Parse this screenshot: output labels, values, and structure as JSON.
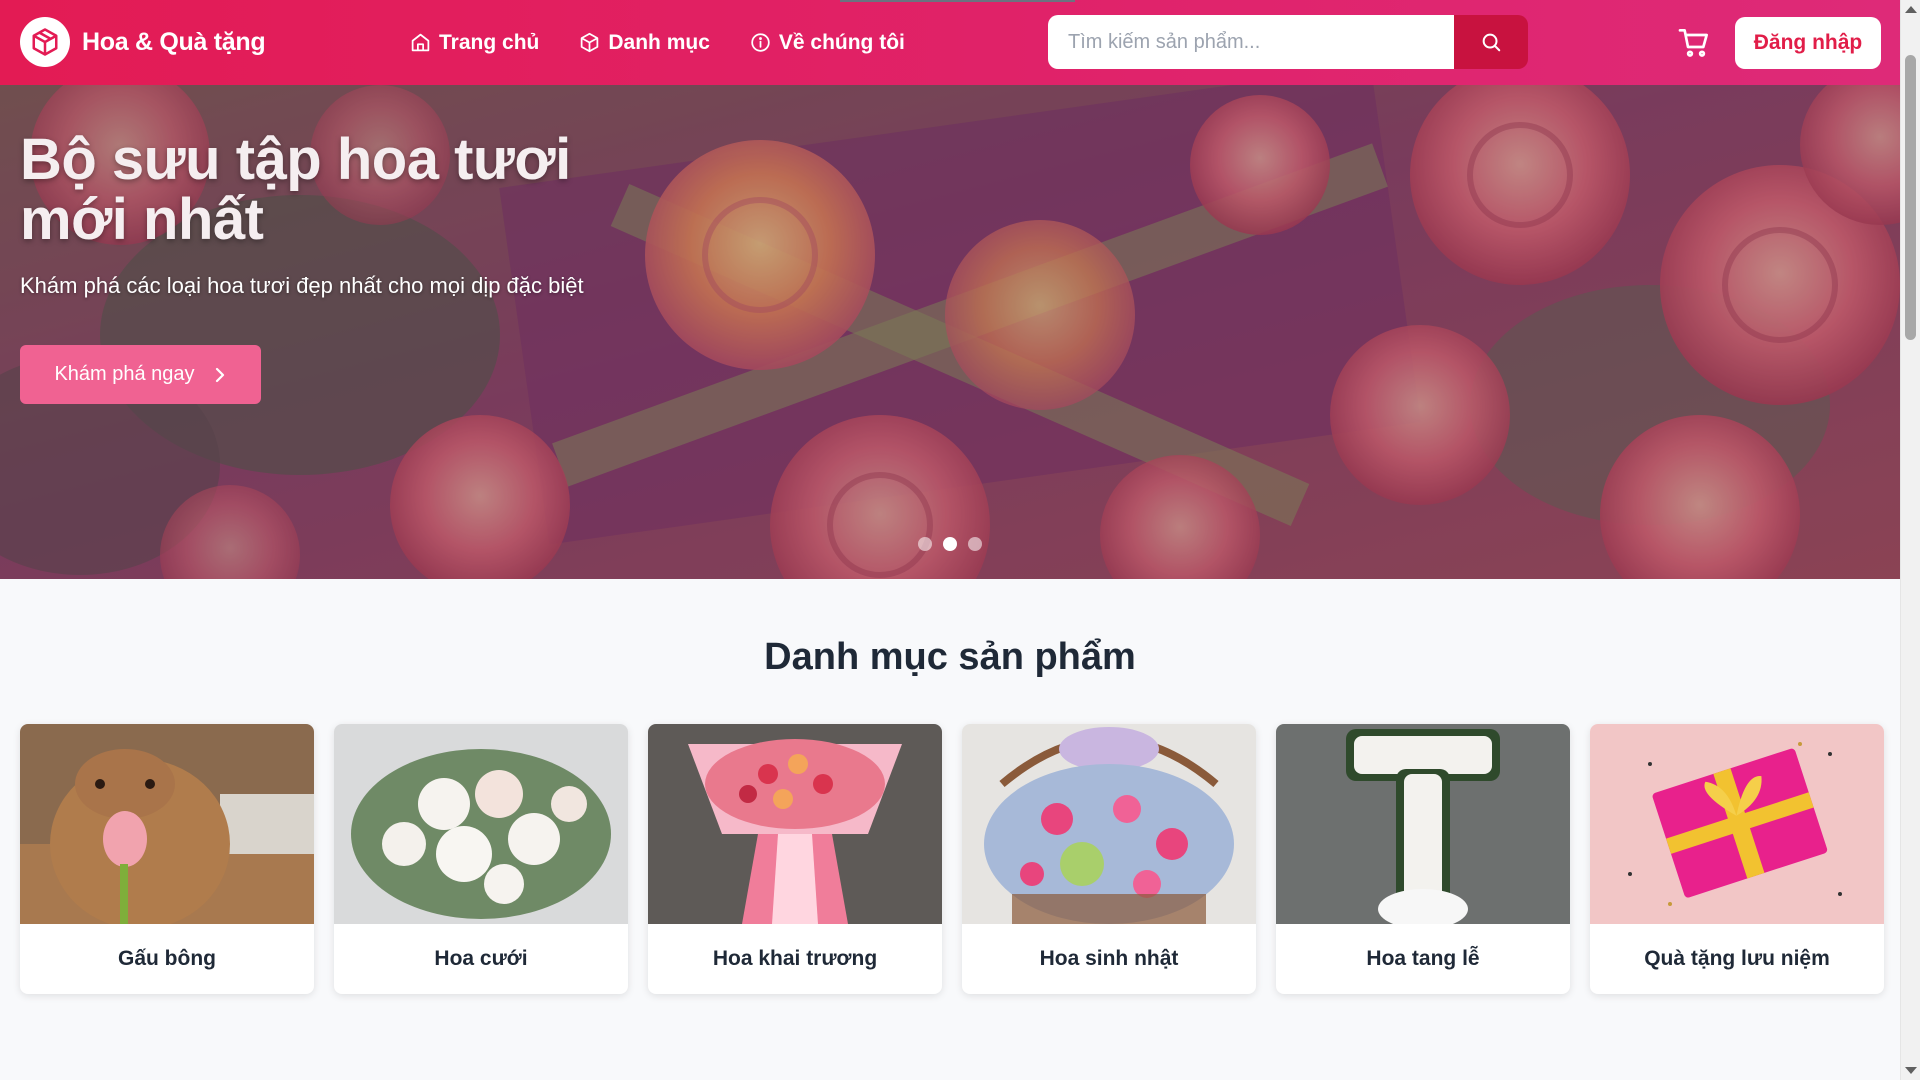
{
  "header": {
    "logo_text": "Hoa & Quà tặng",
    "nav": [
      {
        "label": "Trang chủ",
        "icon": "home-icon"
      },
      {
        "label": "Danh mục",
        "icon": "box-icon"
      },
      {
        "label": "Về chúng tôi",
        "icon": "info-icon"
      }
    ],
    "search_placeholder": "Tìm kiếm sản phẩm...",
    "login_label": "Đăng nhập",
    "colors": {
      "primary": "#e31b54",
      "accent": "#de2a78",
      "search_button": "#c8123f"
    }
  },
  "hero": {
    "title": "Bộ sưu tập hoa tươi mới nhất",
    "subtitle": "Khám phá các loại hoa tươi đẹp nhất cho mọi dịp đặc biệt",
    "cta_label": "Khám phá ngay",
    "slides_total": 3,
    "active_slide": 2,
    "cta_color": "#f06292"
  },
  "categories": {
    "title": "Danh mục sản phẩm",
    "items": [
      {
        "label": "Gấu bông"
      },
      {
        "label": "Hoa cưới"
      },
      {
        "label": "Hoa khai trương"
      },
      {
        "label": "Hoa sinh nhật"
      },
      {
        "label": "Hoa tang lễ"
      },
      {
        "label": "Quà tặng lưu niệm"
      }
    ]
  }
}
